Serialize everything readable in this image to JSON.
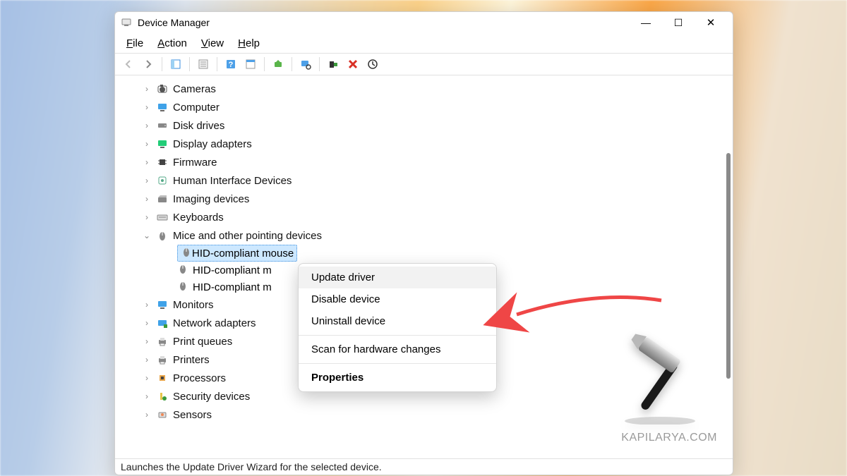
{
  "window": {
    "title": "Device Manager"
  },
  "caption": {
    "minimize": "—",
    "maximize": "☐",
    "close": "✕"
  },
  "menu": {
    "file": "File",
    "action": "Action",
    "view": "View",
    "help": "Help"
  },
  "tree": {
    "categories": [
      {
        "label": "Cameras",
        "icon": "camera",
        "expanded": false
      },
      {
        "label": "Computer",
        "icon": "monitor",
        "expanded": false
      },
      {
        "label": "Disk drives",
        "icon": "disk",
        "expanded": false
      },
      {
        "label": "Display adapters",
        "icon": "display",
        "expanded": false
      },
      {
        "label": "Firmware",
        "icon": "chip",
        "expanded": false
      },
      {
        "label": "Human Interface Devices",
        "icon": "hid",
        "expanded": false
      },
      {
        "label": "Imaging devices",
        "icon": "imaging",
        "expanded": false
      },
      {
        "label": "Keyboards",
        "icon": "keyboard",
        "expanded": false
      },
      {
        "label": "Mice and other pointing devices",
        "icon": "mouse",
        "expanded": true,
        "children": [
          {
            "label": "HID-compliant mouse",
            "icon": "mouse",
            "selected": true
          },
          {
            "label": "HID-compliant mouse",
            "icon": "mouse",
            "truncated": true
          },
          {
            "label": "HID-compliant mouse",
            "icon": "mouse",
            "truncated": true
          }
        ]
      },
      {
        "label": "Monitors",
        "icon": "monitor",
        "expanded": false
      },
      {
        "label": "Network adapters",
        "icon": "network",
        "expanded": false
      },
      {
        "label": "Print queues",
        "icon": "printer",
        "expanded": false
      },
      {
        "label": "Printers",
        "icon": "printer",
        "expanded": false
      },
      {
        "label": "Processors",
        "icon": "processor",
        "expanded": false
      },
      {
        "label": "Security devices",
        "icon": "security",
        "expanded": false
      },
      {
        "label": "Sensors",
        "icon": "sensor",
        "expanded": false
      }
    ]
  },
  "context_menu": {
    "update_driver": "Update driver",
    "disable_device": "Disable device",
    "uninstall_device": "Uninstall device",
    "scan_hardware": "Scan for hardware changes",
    "properties": "Properties"
  },
  "statusbar": {
    "text": "Launches the Update Driver Wizard for the selected device."
  },
  "watermark": {
    "text": "KAPILARYA.COM"
  }
}
